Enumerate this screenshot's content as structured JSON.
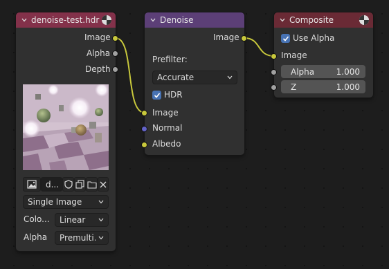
{
  "image_node": {
    "title": "denoise-test.hdr",
    "outputs": [
      "Image",
      "Alpha",
      "Depth"
    ],
    "image_name": "d...",
    "source": "Single Image",
    "color_label": "Colo...",
    "color_value": "Linear",
    "alpha_label": "Alpha",
    "alpha_value": "Premulti...",
    "header_color": "#83314a"
  },
  "denoise_node": {
    "title": "Denoise",
    "output": "Image",
    "prefilter_label": "Prefilter:",
    "prefilter_value": "Accurate",
    "hdr_label": "HDR",
    "hdr_checked": true,
    "inputs": [
      "Image",
      "Normal",
      "Albedo"
    ],
    "header_color": "#5c3f77"
  },
  "composite_node": {
    "title": "Composite",
    "use_alpha_label": "Use Alpha",
    "use_alpha_checked": true,
    "input": "Image",
    "fields": [
      {
        "label": "Alpha",
        "value": "1.000"
      },
      {
        "label": "Z",
        "value": "1.000"
      }
    ],
    "header_color": "#6a2a35"
  },
  "colors": {
    "image_socket": "#c8c83c",
    "value_socket": "#a1a1a1",
    "vector_socket": "#6363c7",
    "link": "#c8c83c",
    "checkbox": "#4772b3"
  }
}
